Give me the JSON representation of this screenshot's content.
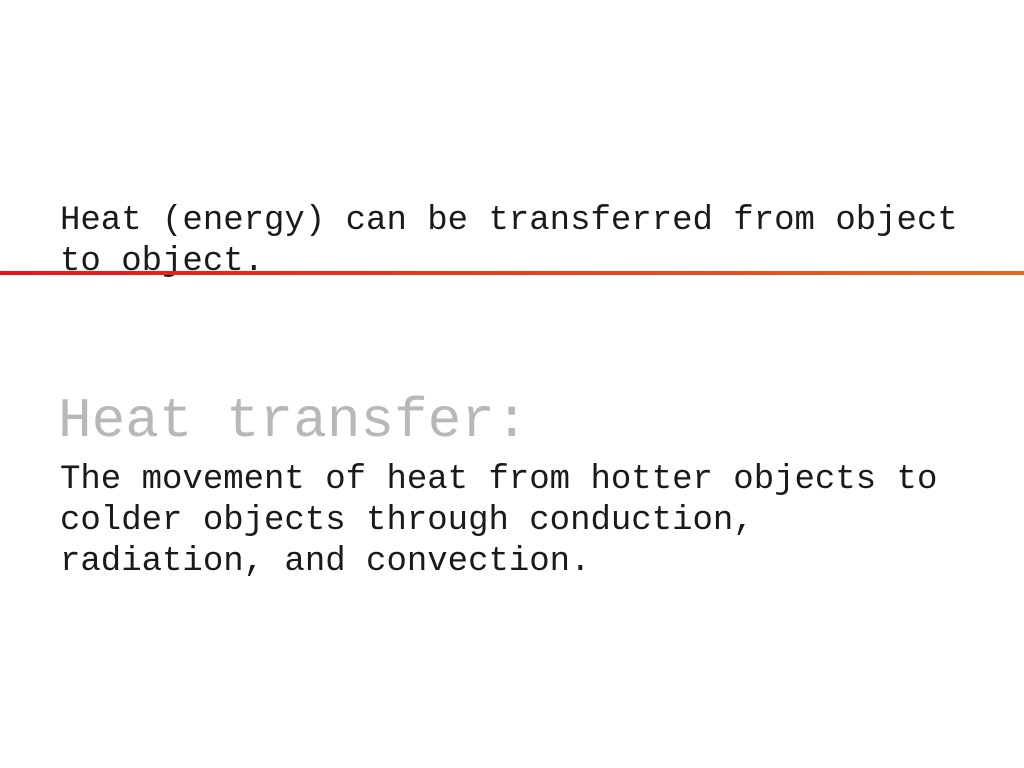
{
  "slide": {
    "intro_lines": [
      "Heat (energy) can be transferred from object",
      "to object."
    ],
    "heading": "Heat transfer:",
    "definition_lines": [
      "The movement of heat from hotter objects to",
      "colder objects through conduction,",
      "radiation, and convection."
    ],
    "colors": {
      "rule_start": "#e8141c",
      "rule_end": "#e06a20",
      "heading": "#b8b8b8"
    }
  }
}
